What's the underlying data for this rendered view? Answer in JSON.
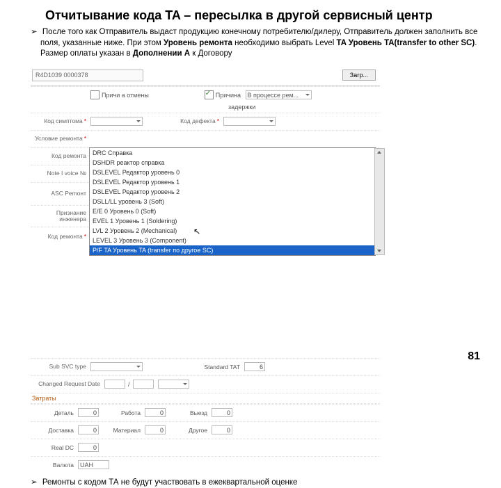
{
  "title": "Отчитывание кода TA – пересылка в другой сервисный центр",
  "bullets": {
    "b1_pre": "После того как Отправитель выдаст продукцию конечному потребителю/дилеру, Отправитель должен заполнить все поля, указанные ниже. При этом ",
    "b1_bold1": "Уровень ремонта",
    "b1_mid": "  необходимо выбрать Level ",
    "b1_bold2": "TA Уровень TA(transfer to other SC)",
    "b1_post": ". Размер оплаты указан в ",
    "b1_bold3": "Дополнении А",
    "b1_post2": " к Договору",
    "b2": "Ремонты с кодом ТА не будут участвовать в ежеквартальной оценке"
  },
  "search_value": "R4D1039 0000378",
  "search_btn": "Загр...",
  "row_check1": "Причи а отмены",
  "row_check2_a": "Причина",
  "row_check2_b": "задержки",
  "select_progress": "В процессе рем...",
  "labels": {
    "symptom": "Код симптома",
    "cond": "Условие ремонта",
    "repair_code": "Код ремонта",
    "note": "Note I voice №",
    "asc": "ASC Pemонт",
    "engineer": "Признание инженера",
    "repair_item": "Код ремонта",
    "kod_defect": "Код дефекта",
    "subsvc": "Sub SVC type",
    "standard_tat": "Standard TAT",
    "changed_date": "Changed Request Date",
    "costs_hdr": "Затраты",
    "detail": "Деталь",
    "work": "Работа",
    "visit": "Выезд",
    "delivery": "Доставка",
    "material": "Материал",
    "other": "Другое",
    "realdc": "Real DC",
    "currency": "Валюта",
    "currency_val": "UAH",
    "slash": "/"
  },
  "dropdown": [
    "DRC    Справка",
    "DSHDR   реактор справка",
    "DSLEVEL  Редактор уровень 0",
    "DSLEVEL  Редактор уровень 1",
    "DSLEVEL  Редактор уровень 2",
    "DSLL/LL  уровень 3 (Soft)",
    "E/E  0   Уровень 0 (Soft)",
    "EVEL 1   Уровень 1 (Soldering)",
    "LVL  2   Уровень 2 (Mechanical)",
    "LEVEL 3  Уровень 3 (Component)"
  ],
  "dropdown_selected": "P/F  TA   Уровень TA (transfer по другое SC)",
  "tat_value": "6",
  "zeros": "0",
  "pagenum": "81"
}
